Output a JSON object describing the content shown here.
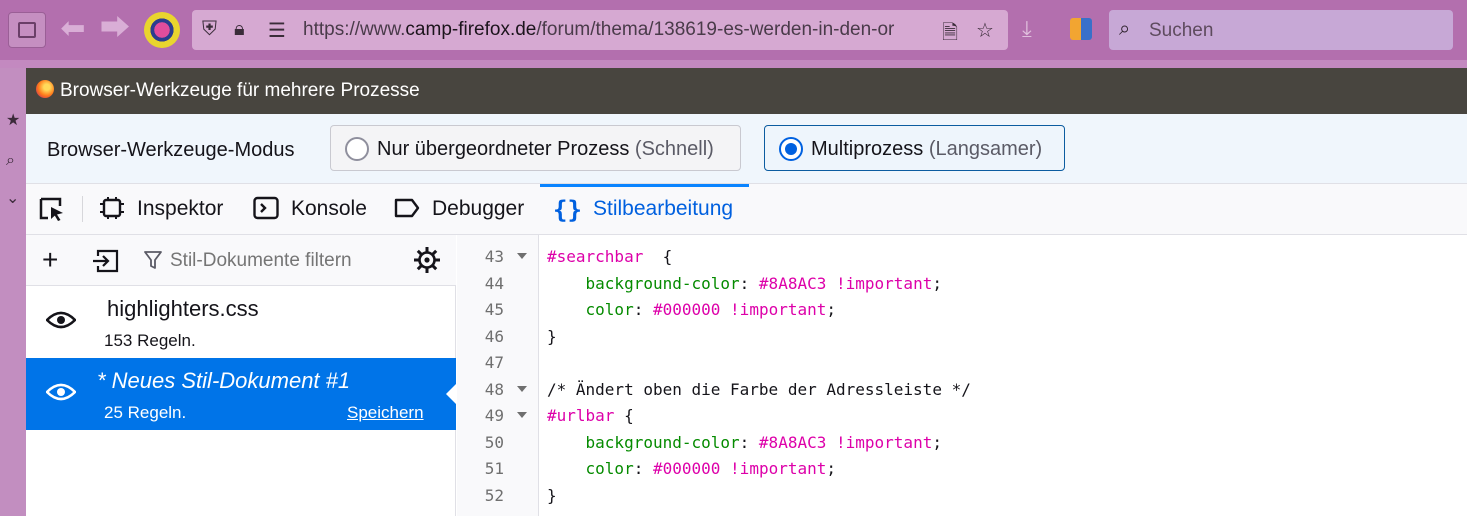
{
  "firefox": {
    "url_prefix": "https://www.",
    "url_domain": "camp-firefox.de",
    "url_path": "/forum/thema/138619-es-werden-in-den-or",
    "search_placeholder": "Suchen"
  },
  "toolbox": {
    "title": "Browser-Werkzeuge für mehrere Prozesse",
    "mode_label": "Browser-Werkzeuge-Modus",
    "mode_options": [
      {
        "label": "Nur übergeordneter Prozess",
        "hint": "(Schnell)",
        "selected": false
      },
      {
        "label": "Multiprozess",
        "hint": "(Langsamer)",
        "selected": true
      }
    ],
    "tabs": [
      {
        "label": "Inspektor",
        "icon": "inspector-icon",
        "active": false
      },
      {
        "label": "Konsole",
        "icon": "console-icon",
        "active": false
      },
      {
        "label": "Debugger",
        "icon": "debugger-icon",
        "active": false
      },
      {
        "label": "Stilbearbeitung",
        "icon": "style-editor-icon",
        "active": true
      }
    ],
    "colors": {
      "accent": "#0074e8",
      "title_bar": "#48453f",
      "code_selector": "#dd00a9",
      "code_property": "#058b00"
    }
  },
  "style_editor": {
    "filter_placeholder": "Stil-Dokumente filtern",
    "sheets": [
      {
        "name": "highlighters.css",
        "rules": "153 Regeln.",
        "selected": false
      },
      {
        "name": "* Neues Stil-Dokument #1",
        "rules": "25 Regeln.",
        "save": "Speichern",
        "selected": true
      }
    ],
    "code_lines": [
      {
        "num": "43",
        "fold": true,
        "selector": "#searchbar",
        "rest": "  {"
      },
      {
        "num": "44",
        "fold": false,
        "indent": "    ",
        "prop": "background-color",
        "value": "#8A8AC3",
        "important": "!important"
      },
      {
        "num": "45",
        "fold": false,
        "indent": "    ",
        "prop": "color",
        "value": "#000000",
        "important": "!important"
      },
      {
        "num": "46",
        "fold": false,
        "text": "}"
      },
      {
        "num": "47",
        "fold": false,
        "text": ""
      },
      {
        "num": "48",
        "fold": true,
        "comment": "/* Ändert oben die Farbe der Adressleiste */"
      },
      {
        "num": "49",
        "fold": true,
        "selector": "#urlbar",
        "rest": " {"
      },
      {
        "num": "50",
        "fold": false,
        "indent": "    ",
        "prop": "background-color",
        "value": "#8A8AC3",
        "important": "!important"
      },
      {
        "num": "51",
        "fold": false,
        "indent": "    ",
        "prop": "color",
        "value": "#000000",
        "important": "!important"
      },
      {
        "num": "52",
        "fold": false,
        "text": "}"
      }
    ]
  }
}
